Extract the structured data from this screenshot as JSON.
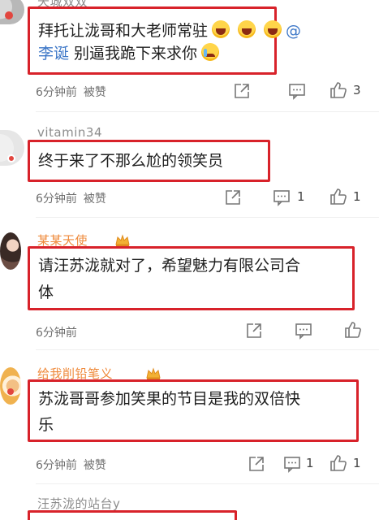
{
  "comments": [
    {
      "username": "天城双双",
      "text_line1": "拜托让泷哥和大老师常驻",
      "text_line1_suffix": "@",
      "text_line2_mention": "李诞",
      "text_line2": " 别逼我跪下来求你",
      "time": "6分钟前",
      "liked_by": "被赞",
      "like_count": "3"
    },
    {
      "username": "vitamin34",
      "text_line1": "终于来了不那么尬的领笑员",
      "time": "6分钟前",
      "liked_by": "被赞",
      "reply_count": "1",
      "like_count": "1"
    },
    {
      "username": "某某天使",
      "text_line1": "请汪苏泷就对了，希望魅力有限公司合",
      "text_line2": "体",
      "time": "6分钟前"
    },
    {
      "username": "给我削铅笔义",
      "text_line1": "苏泷哥哥参加笑果的节目是我的双倍快",
      "text_line2": "乐",
      "time": "6分钟前",
      "liked_by": "被赞",
      "reply_count": "1",
      "like_count": "1"
    },
    {
      "username": "汪苏泷的站台y"
    }
  ],
  "icons": {
    "share": "share-icon",
    "comment": "comment-icon",
    "like": "thumbs-up-icon",
    "crown": "vip-crown-icon",
    "emoji_laugh": "laughing-face-emoji",
    "emoji_cry": "crying-face-emoji"
  },
  "colors": {
    "highlight_border": "#d8222a",
    "username_orange": "#ef8a3b",
    "username_grey": "#8c8c8c",
    "mention_blue": "#3d77c7"
  }
}
